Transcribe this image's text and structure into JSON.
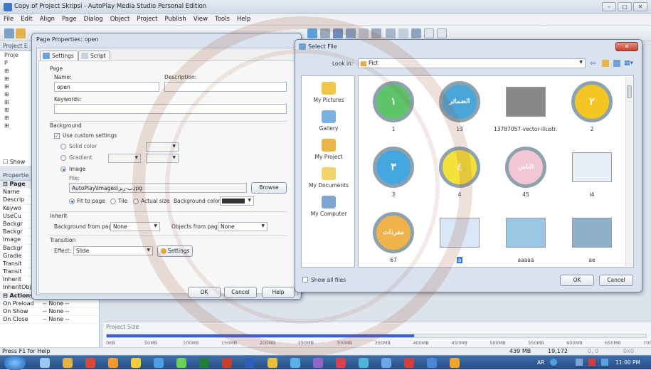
{
  "window": {
    "title": "Copy of Project Skripsi - AutoPlay Media Studio Personal Edition",
    "controls": [
      "minimize-icon",
      "maximize-icon",
      "close-icon"
    ]
  },
  "menu": [
    "File",
    "Edit",
    "Align",
    "Page",
    "Dialog",
    "Object",
    "Project",
    "Publish",
    "View",
    "Tools",
    "Help"
  ],
  "project_panel": {
    "header": "Project E",
    "tree": [
      "Proje",
      "P",
      "⊞",
      "⊞",
      "⊞",
      "⊞",
      "⊞",
      "⊞",
      "⊞",
      "⊞"
    ],
    "show_label": "Show"
  },
  "properties_panel": {
    "header": "Propertie",
    "group_page": "Page",
    "rows": [
      "Name",
      "Descrip",
      "Keywo",
      "UseCu",
      "Backgr",
      "Backgr",
      "Image",
      "Backgr",
      "Gradie",
      "Transit",
      "Transit",
      "Inherit",
      "InheritObjects"
    ],
    "group_actions": "Actions",
    "actions": [
      {
        "name": "On Preload",
        "value": "-- None --"
      },
      {
        "name": "On Show",
        "value": "-- None --"
      },
      {
        "name": "On Close",
        "value": "-- None --"
      }
    ]
  },
  "status": {
    "hint": "Press F1 for Help",
    "memory": "439 MB",
    "size": "19,172",
    "pos": "0, 0",
    "dim": "0x0"
  },
  "project_size": {
    "label": "Project Size",
    "fill": 0.57,
    "ticks": [
      "0KB",
      "50MB",
      "100MB",
      "150MB",
      "200MB",
      "250MB",
      "300MB",
      "350MB",
      "400MB",
      "450MB",
      "500MB",
      "550MB",
      "600MB",
      "650MB",
      "700MB"
    ]
  },
  "page_properties": {
    "title": "Page Properties: open",
    "tabs": [
      "Settings",
      "Script"
    ],
    "page_group": "Page",
    "name_label": "Name:",
    "name_value": "open",
    "desc_label": "Description:",
    "desc_value": "",
    "keywords_label": "Keywords:",
    "keywords_value": "",
    "background_group": "Background",
    "use_custom": "Use custom settings",
    "solid_color": "Solid color",
    "gradient": "Gradient",
    "image": "Image",
    "file_label": "File:",
    "file_value": "AutoPlay\\Images\\ب-ريز.jpg",
    "browse": "Browse",
    "fit_to_page": "Fit to page",
    "tile": "Tile",
    "actual_size": "Actual size",
    "bg_color_label": "Background color:",
    "inherit_group": "Inherit",
    "bg_from_page_label": "Background from page:",
    "bg_from_page_value": "None",
    "obj_from_page_label": "Objects from page:",
    "obj_from_page_value": "None",
    "transition_group": "Transition",
    "effect_label": "Effect:",
    "effect_value": "Slide",
    "settings_btn": "Settings",
    "ok": "OK",
    "cancel": "Cancel",
    "help": "Help"
  },
  "select_file": {
    "title": "Select File",
    "look_in_label": "Look in:",
    "look_in_value": "Pict",
    "places": [
      "My Pictures",
      "Gallery",
      "My Project",
      "My Documents",
      "My Computer"
    ],
    "files": [
      {
        "name": "1",
        "glyph": "١",
        "color": "#5ec46a",
        "kind": "circle"
      },
      {
        "name": "13",
        "glyph": "الضمائر",
        "color": "#4aa6d8",
        "kind": "circle"
      },
      {
        "name": "13787057-vector-illustr...",
        "glyph": "",
        "color": "#888",
        "kind": "tv"
      },
      {
        "name": "2",
        "glyph": "٢",
        "color": "#f3c623",
        "kind": "circle"
      },
      {
        "name": "3",
        "glyph": "٣",
        "color": "#45a7df",
        "kind": "circle"
      },
      {
        "name": "4",
        "glyph": "٤",
        "color": "#f4e23a",
        "kind": "circle"
      },
      {
        "name": "45",
        "glyph": "الناس",
        "color": "#f1c7d6",
        "kind": "circle"
      },
      {
        "name": "i4",
        "glyph": "",
        "color": "#e8eef6",
        "kind": "board"
      },
      {
        "name": "67",
        "glyph": "مفردات",
        "color": "#f0b24a",
        "kind": "circle"
      },
      {
        "name": "a",
        "glyph": "",
        "color": "#d9e8f6",
        "kind": "board"
      },
      {
        "name": "aaaaa",
        "glyph": "",
        "color": "#9bc7e4",
        "kind": "photo"
      },
      {
        "name": "ae",
        "glyph": "",
        "color": "#8fb0c9",
        "kind": "photo"
      }
    ],
    "show_all_files": "Show all files",
    "ok": "OK",
    "cancel": "Cancel"
  },
  "tray": {
    "lang": "AR",
    "clock": "11:00 PM"
  }
}
